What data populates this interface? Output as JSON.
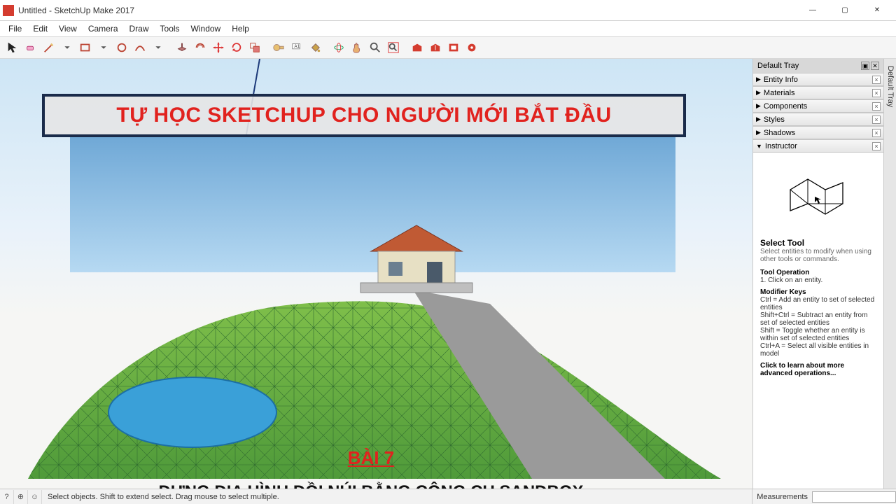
{
  "window": {
    "title": "Untitled - SketchUp Make 2017",
    "min": "—",
    "max": "▢",
    "close": "✕"
  },
  "menu": [
    "File",
    "Edit",
    "View",
    "Camera",
    "Draw",
    "Tools",
    "Window",
    "Help"
  ],
  "toolbar_icons": [
    "select-arrow",
    "eraser",
    "pencil",
    "line-dropdown",
    "rectangle",
    "rectangle-dropdown",
    "circle",
    "arc",
    "arc-dropdown",
    "push-pull",
    "offset",
    "move",
    "rotate",
    "scale",
    "tape-measure",
    "text-label",
    "paint-bucket",
    "orbit",
    "pan",
    "zoom",
    "zoom-extents",
    "warehouse-3d",
    "warehouse-share",
    "extension-warehouse",
    "layers-red"
  ],
  "overlay": {
    "title": "TỰ HỌC SKETCHUP CHO NGƯỜI MỚI BẮT ĐẦU",
    "lesson": "BÀI 7",
    "subtitle": "DỰNG ĐỊA HÌNH ĐỒI NÚI BẰNG CÔNG CỤ SANDBOX"
  },
  "tray": {
    "title": "Default Tray",
    "tab_label": "Default Tray",
    "panels": [
      "Entity Info",
      "Materials",
      "Components",
      "Styles",
      "Shadows",
      "Instructor"
    ]
  },
  "instructor": {
    "tool_name": "Select Tool",
    "tool_desc": "Select entities to modify when using other tools or commands.",
    "operation_head": "Tool Operation",
    "operation_1": "1. Click on an entity.",
    "modkeys_head": "Modifier Keys",
    "mk1": "Ctrl = Add an entity to set of selected entities",
    "mk2": "Shift+Ctrl = Subtract an entity from set of selected entities",
    "mk3": "Shift = Toggle whether an entity is within set of selected entities",
    "mk4": "Ctrl+A = Select all visible entities in model",
    "more": "Click to learn about more advanced operations..."
  },
  "status": {
    "hint": "Select objects. Shift to extend select. Drag mouse to select multiple.",
    "measurements_label": "Measurements"
  }
}
